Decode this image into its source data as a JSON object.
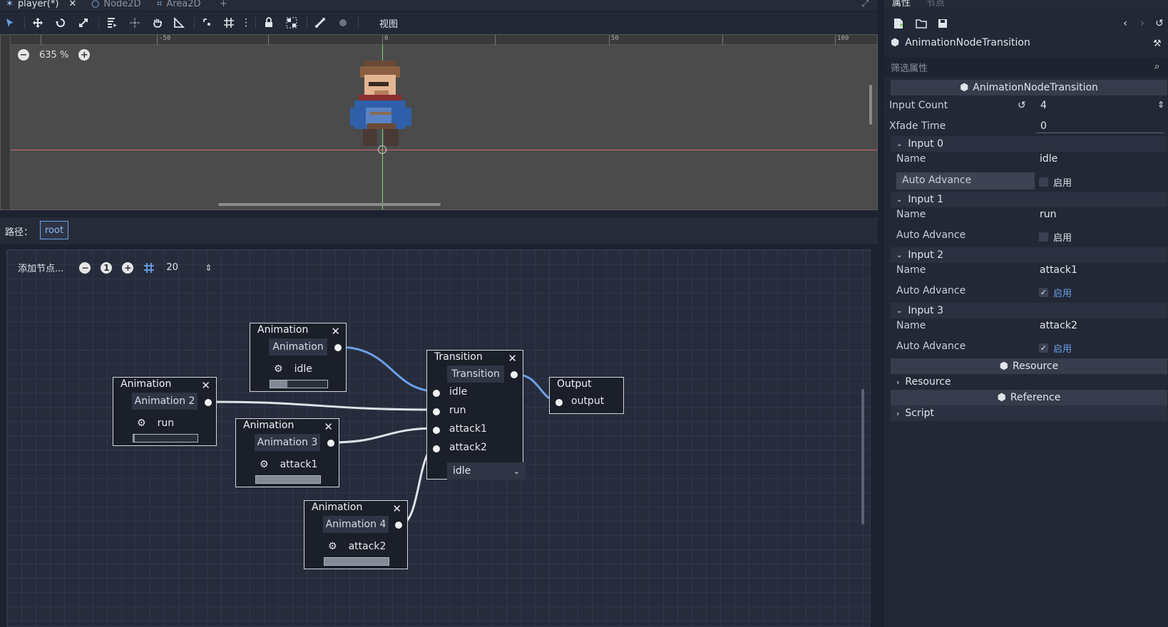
{
  "editor_tabs": [
    {
      "label": "player(*)",
      "active": true
    },
    {
      "label": "Node2D",
      "active": false
    },
    {
      "label": "Area2D",
      "active": false
    }
  ],
  "toolbar2d": {
    "view_menu": "视图"
  },
  "viewport": {
    "zoom_label": "635 %",
    "ruler_labels": [
      "-50",
      "0",
      "50",
      "100"
    ]
  },
  "pathbar": {
    "label": "路径：",
    "root": "root"
  },
  "graph": {
    "add_node_label": "添加节点...",
    "snap_value": "20",
    "nodes": {
      "anim1": {
        "title": "Animation",
        "name": "Animation",
        "clip": "idle",
        "progress": 0.3
      },
      "anim2": {
        "title": "Animation",
        "name": "Animation 2",
        "clip": "run",
        "progress": 0.02
      },
      "anim3": {
        "title": "Animation",
        "name": "Animation 3",
        "clip": "attack1",
        "progress": 1.0
      },
      "anim4": {
        "title": "Animation",
        "name": "Animation 4",
        "clip": "attack2",
        "progress": 1.0
      },
      "transition": {
        "title": "Transition",
        "name": "Transition",
        "inputs": [
          "idle",
          "run",
          "attack1",
          "attack2"
        ],
        "current": "idle"
      },
      "output": {
        "title": "Output",
        "port": "output"
      }
    }
  },
  "inspector": {
    "tabs": [
      "属性",
      "节点"
    ],
    "resource_type": "AnimationNodeTransition",
    "filter_placeholder": "筛选属性",
    "section_title": "AnimationNodeTransition",
    "input_count_label": "Input Count",
    "input_count": "4",
    "xfade_label": "Xfade Time",
    "xfade": "0",
    "inputs": [
      {
        "header": "Input 0",
        "name_label": "Name",
        "name": "idle",
        "advance_label": "Auto Advance",
        "enabled": false,
        "enabled_label": "启用"
      },
      {
        "header": "Input 1",
        "name_label": "Name",
        "name": "run",
        "advance_label": "Auto Advance",
        "enabled": false,
        "enabled_label": "启用"
      },
      {
        "header": "Input 2",
        "name_label": "Name",
        "name": "attack1",
        "advance_label": "Auto Advance",
        "enabled": true,
        "enabled_label": "启用"
      },
      {
        "header": "Input 3",
        "name_label": "Name",
        "name": "attack2",
        "advance_label": "Auto Advance",
        "enabled": true,
        "enabled_label": "启用"
      }
    ],
    "resource_section": "Resource",
    "resource_group": "Resource",
    "reference_section": "Reference",
    "script_group": "Script"
  },
  "colors": {
    "accent": "#6aa0e8",
    "panel": "#232836",
    "graph_bg": "#262c3b",
    "viewport_bg": "#4b4b4b"
  }
}
